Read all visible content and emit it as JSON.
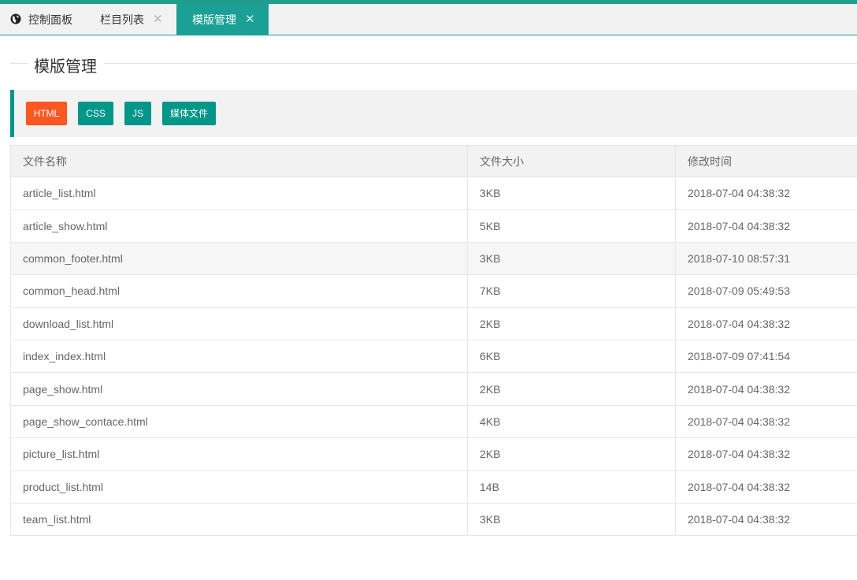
{
  "tabs": [
    {
      "label": "控制面板",
      "icon": "globe-icon",
      "active": false,
      "closable": false
    },
    {
      "label": "栏目列表",
      "active": false,
      "closable": true
    },
    {
      "label": "模版管理",
      "active": true,
      "closable": true
    }
  ],
  "close_glyph": "✕",
  "page_title": "模版管理",
  "buttons": {
    "html": "HTML",
    "css": "CSS",
    "js": "JS",
    "media": "媒体文件"
  },
  "colors": {
    "accent": "#1aa094",
    "orange": "#ff5722",
    "teal": "#009688"
  },
  "table": {
    "headers": [
      "文件名称",
      "文件大小",
      "修改时间"
    ],
    "rows": [
      [
        "article_list.html",
        "3KB",
        "2018-07-04 04:38:32"
      ],
      [
        "article_show.html",
        "5KB",
        "2018-07-04 04:38:32"
      ],
      [
        "common_footer.html",
        "3KB",
        "2018-07-10 08:57:31"
      ],
      [
        "common_head.html",
        "7KB",
        "2018-07-09 05:49:53"
      ],
      [
        "download_list.html",
        "2KB",
        "2018-07-04 04:38:32"
      ],
      [
        "index_index.html",
        "6KB",
        "2018-07-09 07:41:54"
      ],
      [
        "page_show.html",
        "2KB",
        "2018-07-04 04:38:32"
      ],
      [
        "page_show_contace.html",
        "4KB",
        "2018-07-04 04:38:32"
      ],
      [
        "picture_list.html",
        "2KB",
        "2018-07-04 04:38:32"
      ],
      [
        "product_list.html",
        "14B",
        "2018-07-04 04:38:32"
      ],
      [
        "team_list.html",
        "3KB",
        "2018-07-04 04:38:32"
      ]
    ]
  }
}
